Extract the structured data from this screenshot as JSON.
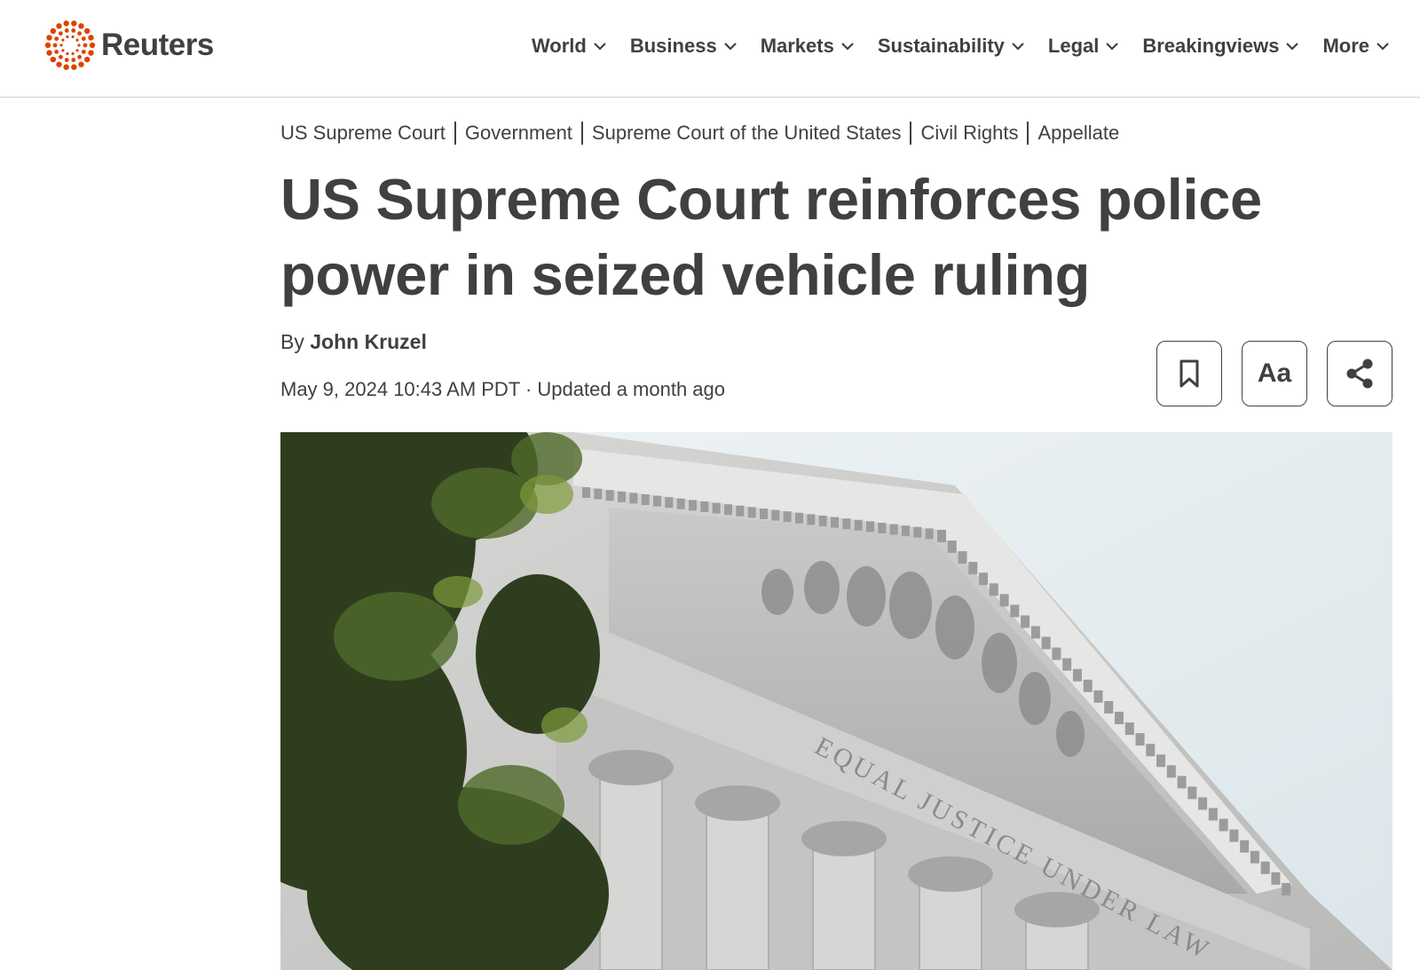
{
  "brand": {
    "name": "Reuters",
    "accent": "#dc4300"
  },
  "nav": {
    "items": [
      {
        "label": "World"
      },
      {
        "label": "Business"
      },
      {
        "label": "Markets"
      },
      {
        "label": "Sustainability"
      },
      {
        "label": "Legal"
      },
      {
        "label": "Breakingviews"
      },
      {
        "label": "More"
      }
    ]
  },
  "breadcrumbs": [
    "US Supreme Court",
    "Government",
    "Supreme Court of the United States",
    "Civil Rights",
    "Appellate"
  ],
  "article": {
    "headline": "US Supreme Court reinforces police power in seized vehicle ruling",
    "byline_prefix": "By",
    "author": "John Kruzel",
    "dateline": "May 9, 2024 10:43 AM PDT · Updated a month ago"
  },
  "toolbar": {
    "bookmark_icon": "bookmark-icon",
    "text_size_label": "Aa",
    "share_icon": "share-icon"
  },
  "hero_image": {
    "frieze_inscription": "EQUAL JUSTICE UNDER LAW"
  }
}
